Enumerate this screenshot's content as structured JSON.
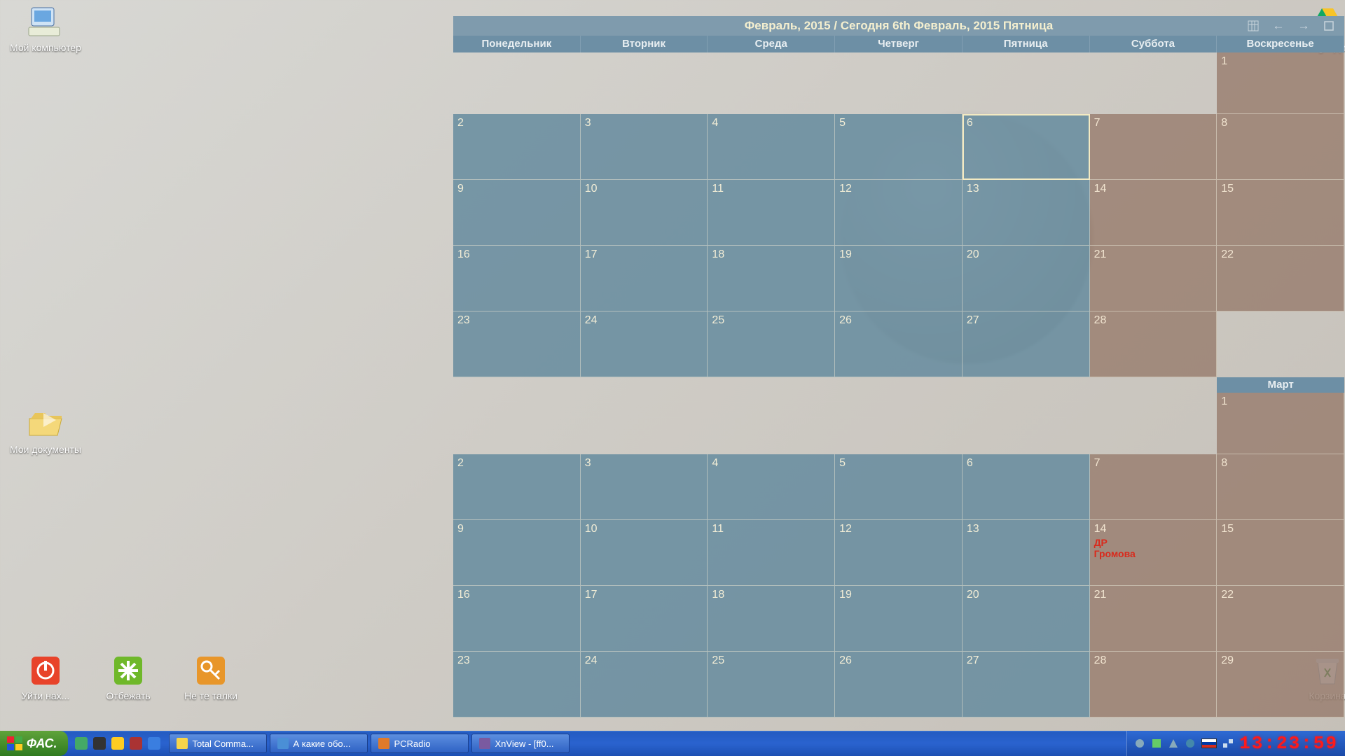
{
  "desktop_icons": {
    "my_computer": "Мой компьютер",
    "my_docs": "Мои документы",
    "shutdown": "Уйти нах...",
    "run": "Отбежать",
    "notepad": "Не те талки",
    "gdrive": "Google Диск",
    "recycle": "Корзина"
  },
  "calendar": {
    "header": "Февраль, 2015 / Сегодня 6th Февраль, 2015 Пятница",
    "dow": [
      "Понедельник",
      "Вторник",
      "Среда",
      "Четверг",
      "Пятница",
      "Суббота",
      "Воскресенье"
    ],
    "today": 6,
    "month2_label": "Март",
    "weeks_feb": [
      [
        "",
        "",
        "",
        "",
        "",
        "",
        "1"
      ],
      [
        "2",
        "3",
        "4",
        "5",
        "6",
        "7",
        "8"
      ],
      [
        "9",
        "10",
        "11",
        "12",
        "13",
        "14",
        "15"
      ],
      [
        "16",
        "17",
        "18",
        "19",
        "20",
        "21",
        "22"
      ],
      [
        "23",
        "24",
        "25",
        "26",
        "27",
        "28",
        ""
      ]
    ],
    "weeks_mar": [
      [
        "",
        "",
        "",
        "",
        "",
        "",
        "1"
      ],
      [
        "2",
        "3",
        "4",
        "5",
        "6",
        "7",
        "8"
      ],
      [
        "9",
        "10",
        "11",
        "12",
        "13",
        "14",
        "15"
      ],
      [
        "16",
        "17",
        "18",
        "19",
        "20",
        "21",
        "22"
      ],
      [
        "23",
        "24",
        "25",
        "26",
        "27",
        "28",
        "29"
      ]
    ],
    "event": {
      "month": "mar",
      "day": "14",
      "text": "ДР\nГромова"
    }
  },
  "taskbar": {
    "start": "ФАС.",
    "tasks": [
      {
        "label": "Total Comma...",
        "color": "#f6d44a"
      },
      {
        "label": "А какие обо...",
        "color": "#4a8fd6"
      },
      {
        "label": "PCRadio",
        "color": "#e07a2a"
      },
      {
        "label": "XnView - [ff0...",
        "color": "#7a5aa0"
      }
    ],
    "clock": "13:23:59"
  }
}
